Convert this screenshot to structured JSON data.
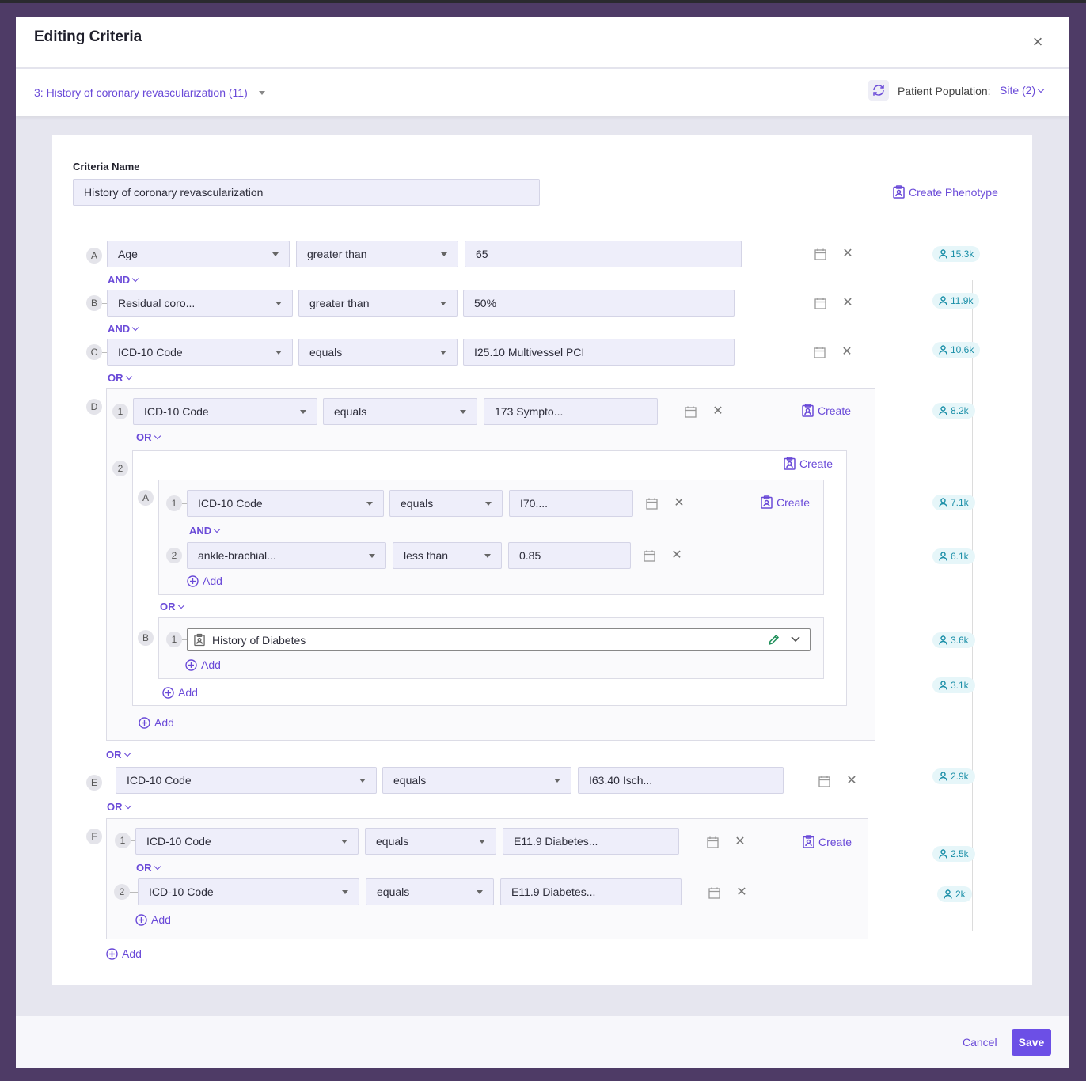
{
  "modal": {
    "title": "Editing Criteria",
    "close_icon": "×",
    "criteria_select": "3: History of coronary revascularization (11)",
    "population_label": "Patient Population:",
    "population_value": "Site (2)"
  },
  "form": {
    "criteria_name_label": "Criteria Name",
    "criteria_name_value": "History of coronary revascularization",
    "create_phenotype": "Create Phenotype"
  },
  "labels": {
    "and": "AND",
    "or": "OR",
    "add": "Add",
    "create": "Create"
  },
  "rows": {
    "A": {
      "letter": "A",
      "field": "Age",
      "op": "greater than",
      "value": "65",
      "count": "15.3k"
    },
    "B": {
      "letter": "B",
      "field": "Residual coro...",
      "op": "greater than",
      "value": "50%",
      "count": "11.9k"
    },
    "C": {
      "letter": "C",
      "field": "ICD-10 Code",
      "op": "equals",
      "value": "I25.10 Multivessel PCI",
      "count": "10.6k"
    },
    "D1": {
      "letter": "D",
      "num": "1",
      "field": "ICD-10 Code",
      "op": "equals",
      "value": "173 Sympto...",
      "count": "8.2k"
    },
    "D2": {
      "num": "2"
    },
    "D2A1": {
      "letter": "A",
      "num": "1",
      "field": "ICD-10 Code",
      "op": "equals",
      "value": "I70....",
      "count": "7.1k"
    },
    "D2A2": {
      "num": "2",
      "field": "ankle-brachial...",
      "op": "less than",
      "value": "0.85",
      "count": "6.1k"
    },
    "D2B1": {
      "letter": "B",
      "num": "1",
      "phenotype": "History of Diabetes",
      "count": "3.6k"
    },
    "D2count": {
      "count": "3.1k"
    },
    "E": {
      "letter": "E",
      "field": "ICD-10 Code",
      "op": "equals",
      "value": "I63.40 Isch...",
      "count": "2.9k"
    },
    "F1": {
      "letter": "F",
      "num": "1",
      "field": "ICD-10 Code",
      "op": "equals",
      "value": "E11.9 Diabetes...",
      "count": "2.5k"
    },
    "F2": {
      "num": "2",
      "field": "ICD-10 Code",
      "op": "equals",
      "value": "E11.9 Diabetes...",
      "count": "2k"
    }
  },
  "footer": {
    "cancel": "Cancel",
    "save": "Save"
  },
  "colors": {
    "accent": "#6c4fe6",
    "count_text": "#1b8fa8",
    "count_bg": "#e6f6f9",
    "frame": "#4e3b66"
  }
}
